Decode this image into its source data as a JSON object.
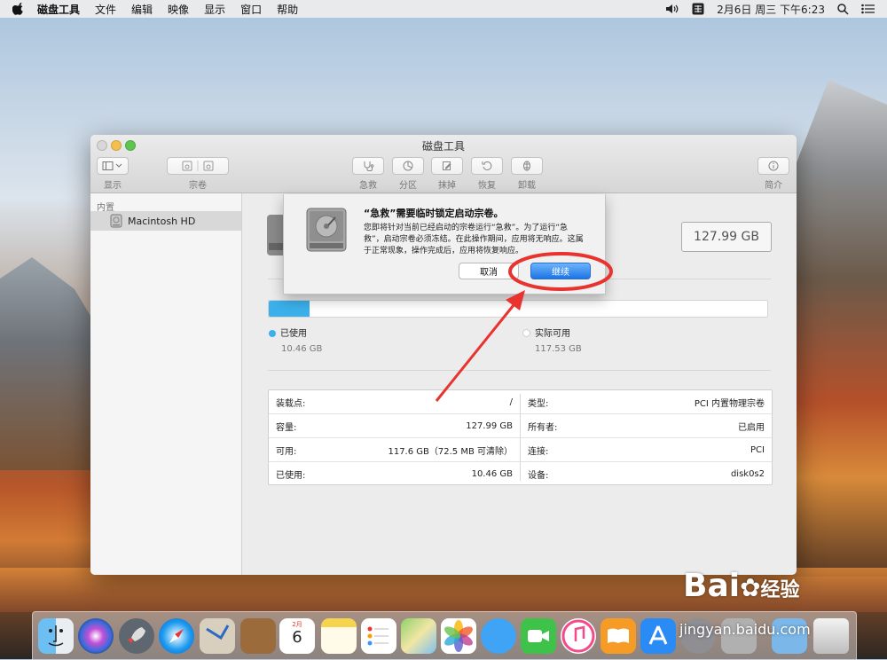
{
  "menubar": {
    "app_name": "磁盘工具",
    "items": [
      "文件",
      "编辑",
      "映像",
      "显示",
      "窗口",
      "帮助"
    ],
    "clock": "2月6日 周三 下午6:23"
  },
  "window": {
    "title": "磁盘工具",
    "toolbar": {
      "view_label": "显示",
      "volume_label": "宗卷",
      "first_aid_label": "急救",
      "partition_label": "分区",
      "erase_label": "抹掉",
      "restore_label": "恢复",
      "unmount_label": "卸载",
      "info_label": "简介"
    },
    "sidebar": {
      "section_header": "内置",
      "items": [
        {
          "label": "Macintosh HD"
        }
      ]
    },
    "main": {
      "capacity": "127.99 GB",
      "usage": {
        "used_fraction": 0.082,
        "used_label": "已使用",
        "used_value": "10.46 GB",
        "available_label": "实际可用",
        "available_value": "117.53 GB"
      },
      "info_left": [
        {
          "key": "装载点:",
          "value": "/"
        },
        {
          "key": "容量:",
          "value": "127.99 GB"
        },
        {
          "key": "可用:",
          "value": "117.6 GB（72.5 MB 可清除）"
        },
        {
          "key": "已使用:",
          "value": "10.46 GB"
        }
      ],
      "info_right": [
        {
          "key": "类型:",
          "value": "PCI 内置物理宗卷"
        },
        {
          "key": "所有者:",
          "value": "已启用"
        },
        {
          "key": "连接:",
          "value": "PCI"
        },
        {
          "key": "设备:",
          "value": "disk0s2"
        }
      ]
    }
  },
  "dialog": {
    "title": "“急救”需要临时锁定启动宗卷。",
    "message": "您即将针对当前已经启动的宗卷运行“急救”。为了运行“急救”，启动宗卷必须冻结。在此操作期间，应用将无响应。这属于正常现象，操作完成后，应用将恢复响应。",
    "cancel_label": "取消",
    "continue_label": "继续"
  },
  "dock": {
    "calendar_month": "2月",
    "calendar_day": "6",
    "icons": [
      "finder-icon",
      "siri-icon",
      "launchpad-icon",
      "safari-icon",
      "mail-icon",
      "contacts-icon",
      "calendar-icon",
      "notes-icon",
      "reminders-icon",
      "maps-icon",
      "photos-icon",
      "messages-icon",
      "facetime-icon",
      "music-icon",
      "books-icon",
      "app-store-icon",
      "system-preferences-icon",
      "disk-utility-icon",
      "downloads-icon",
      "trash-icon"
    ]
  },
  "watermark": {
    "brand": "Bai",
    "brand_suffix": "经验",
    "url": "jingyan.baidu.com"
  },
  "colors": {
    "accent": "#3bb0ea",
    "annotation": "#e8332f",
    "default_button": "#2f7fe6"
  }
}
